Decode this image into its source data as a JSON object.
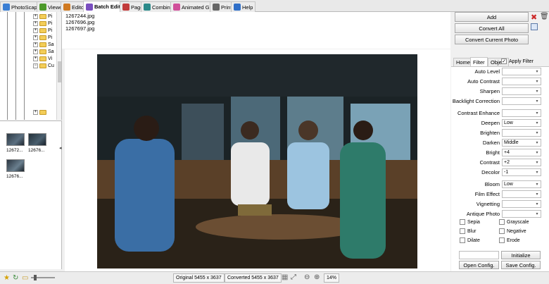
{
  "tabs": [
    {
      "label": "PhotoScape",
      "icon": "photoscape-icon",
      "color": "#3b7fd4"
    },
    {
      "label": "Viewer",
      "icon": "viewer-icon",
      "color": "#4c9a2a"
    },
    {
      "label": "Editor",
      "icon": "editor-icon",
      "color": "#d07a22"
    },
    {
      "label": "Batch Editor",
      "icon": "batch-editor-icon",
      "color": "#7a4fc0"
    },
    {
      "label": "Page",
      "icon": "page-icon",
      "color": "#c23b3b"
    },
    {
      "label": "Combine",
      "icon": "combine-icon",
      "color": "#2b8a8a"
    },
    {
      "label": "Animated GIF",
      "icon": "gif-icon",
      "color": "#d04f9a"
    },
    {
      "label": "Print",
      "icon": "print-icon",
      "color": "#666666"
    },
    {
      "label": "Help",
      "icon": "help-icon",
      "color": "#2f6fc8"
    }
  ],
  "tree": {
    "nodes": [
      "Pi",
      "Pi",
      "Pi",
      "Pi",
      "Sa",
      "Sa",
      "Vi",
      "Cu"
    ]
  },
  "files": [
    "1267244.jpg",
    "1267696.jpg",
    "1267697.jpg"
  ],
  "thumbnails": [
    "12672...",
    "12676...",
    "12676..."
  ],
  "status": {
    "original": "Original 5455 x 3637",
    "converted": "Converted 5455 x 3637",
    "zoom": "14%"
  },
  "panel": {
    "add": "Add",
    "convert_all": "Convert All",
    "convert_current": "Convert Current Photo",
    "subtabs": [
      "Home",
      "Filter",
      "Object"
    ],
    "apply_filter": "Apply Filter",
    "filters": [
      {
        "label": "Auto Level",
        "value": ""
      },
      {
        "label": "Auto Contrast",
        "value": ""
      },
      {
        "label": "Sharpen",
        "value": ""
      },
      {
        "label": "Backlight Correction",
        "value": ""
      },
      {
        "label": "Contrast Enhance",
        "value": ""
      },
      {
        "label": "Deepen",
        "value": "Low"
      },
      {
        "label": "Brighten",
        "value": ""
      },
      {
        "label": "Darken",
        "value": "Middle"
      },
      {
        "label": "Bright",
        "value": "+4"
      },
      {
        "label": "Contrast",
        "value": "+2"
      },
      {
        "label": "Decolor",
        "value": "-1"
      },
      {
        "label": "Bloom",
        "value": "Low"
      },
      {
        "label": "Film Effect",
        "value": ""
      },
      {
        "label": "Vignetting",
        "value": ""
      },
      {
        "label": "Antique Photo",
        "value": ""
      }
    ],
    "checks": [
      "Sepia",
      "Grayscale",
      "Blur",
      "Negative",
      "Dilate",
      "Erode"
    ],
    "initialize": "Initialize",
    "open_config": "Open Config.",
    "save_config": "Save Config."
  }
}
